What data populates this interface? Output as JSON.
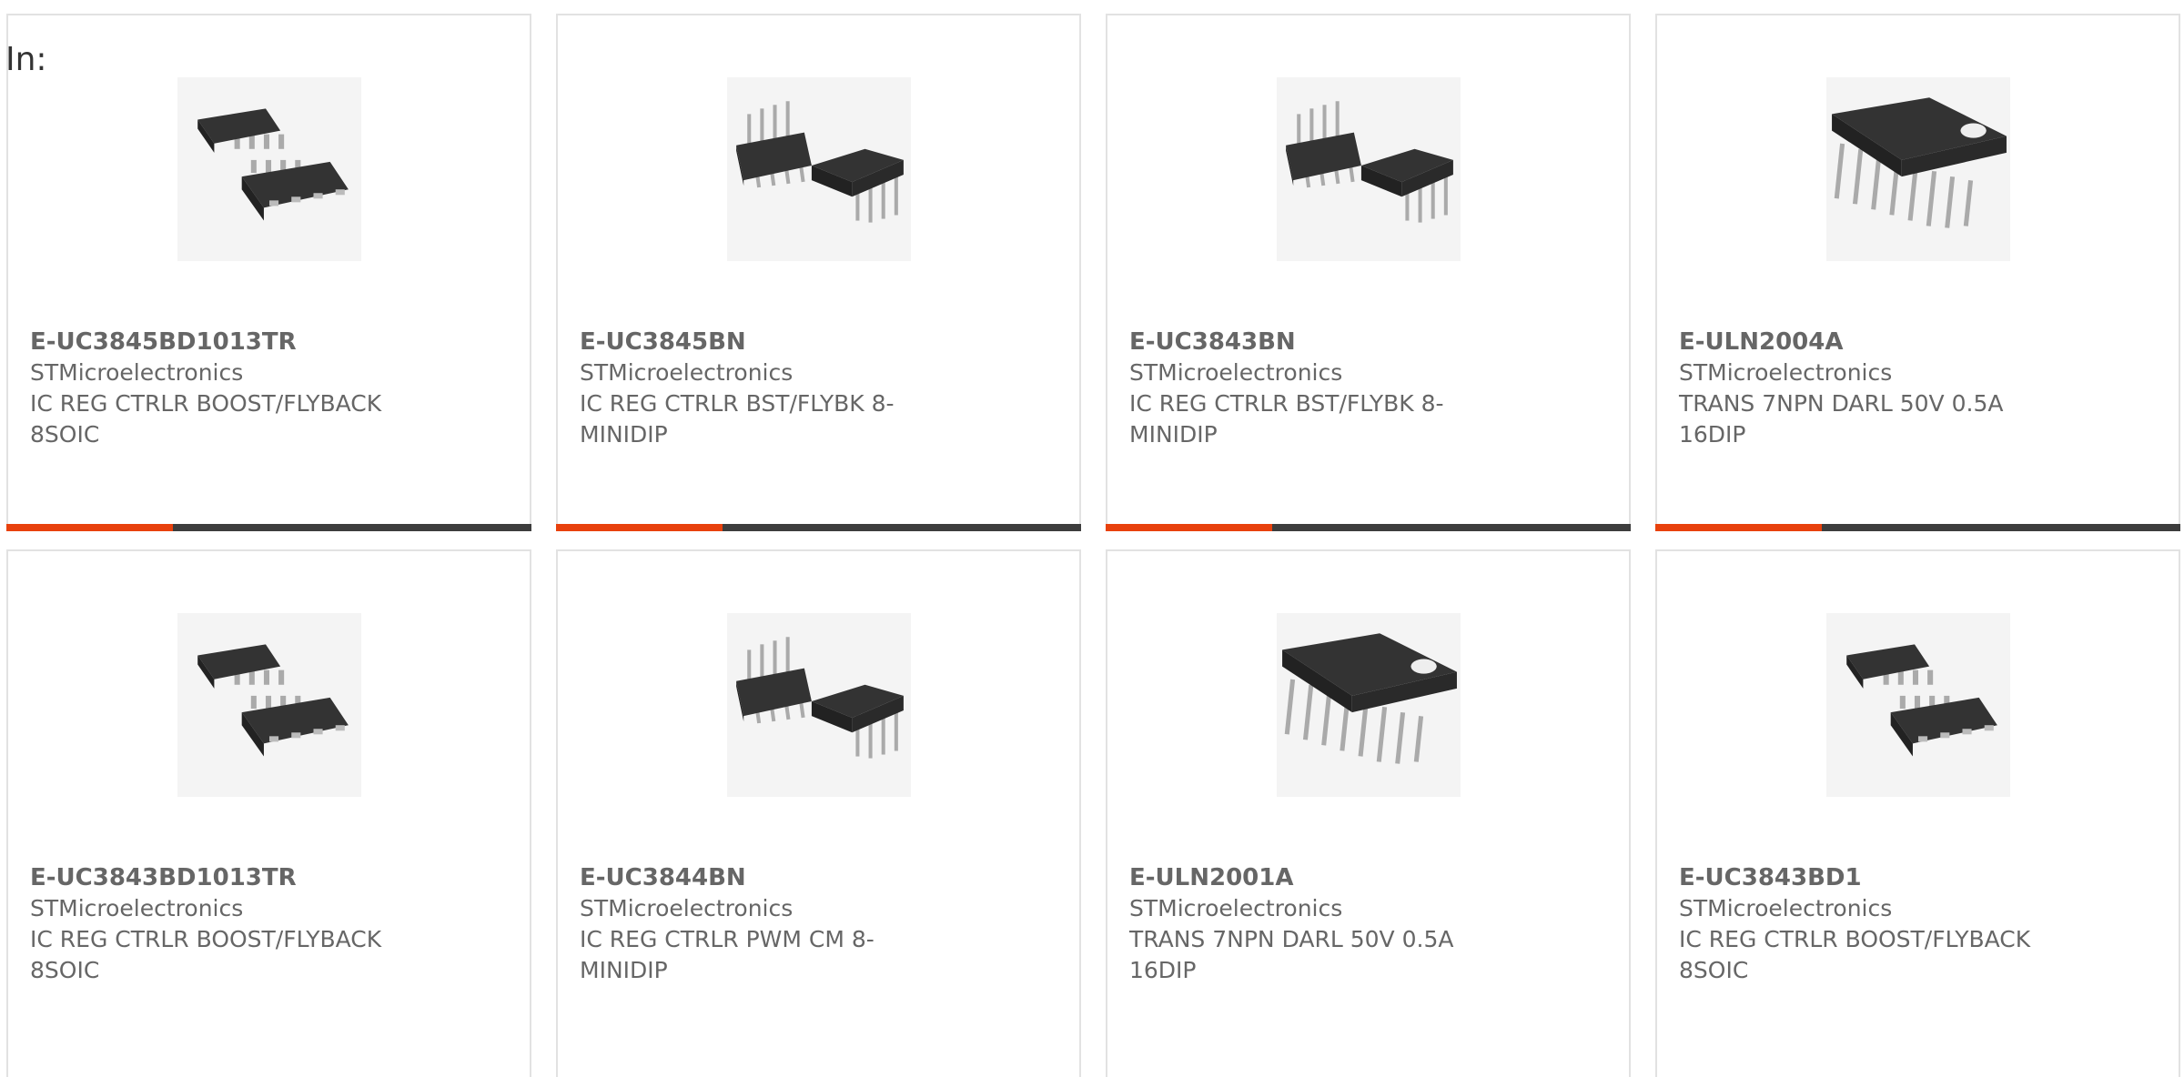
{
  "filter_label": "In:",
  "colors": {
    "accent": "#e8410d",
    "bar": "#3d3d3d",
    "text": "#666666",
    "border": "#e2e2e2"
  },
  "products": [
    {
      "part_number": "E-UC3845BD1013TR",
      "manufacturer": "STMicroelectronics",
      "description": "IC REG CTRLR BOOST/FLYBACK 8SOIC",
      "image": "soic8-icon"
    },
    {
      "part_number": "E-UC3845BN",
      "manufacturer": "STMicroelectronics",
      "description": "IC REG CTRLR BST/FLYBK 8-MINIDIP",
      "image": "dip8-icon"
    },
    {
      "part_number": "E-UC3843BN",
      "manufacturer": "STMicroelectronics",
      "description": "IC REG CTRLR BST/FLYBK 8-MINIDIP",
      "image": "dip8-icon"
    },
    {
      "part_number": "E-ULN2004A",
      "manufacturer": "STMicroelectronics",
      "description": "TRANS 7NPN DARL 50V 0.5A 16DIP",
      "image": "dip16-icon"
    },
    {
      "part_number": "E-UC3843BD1013TR",
      "manufacturer": "STMicroelectronics",
      "description": "IC REG CTRLR BOOST/FLYBACK 8SOIC",
      "image": "soic8-icon"
    },
    {
      "part_number": "E-UC3844BN",
      "manufacturer": "STMicroelectronics",
      "description": "IC REG CTRLR PWM CM 8-MINIDIP",
      "image": "dip8-icon"
    },
    {
      "part_number": "E-ULN2001A",
      "manufacturer": "STMicroelectronics",
      "description": "TRANS 7NPN DARL 50V 0.5A 16DIP",
      "image": "dip16-icon"
    },
    {
      "part_number": "E-UC3843BD1",
      "manufacturer": "STMicroelectronics",
      "description": "IC REG CTRLR BOOST/FLYBACK 8SOIC",
      "image": "soic8-icon"
    }
  ]
}
